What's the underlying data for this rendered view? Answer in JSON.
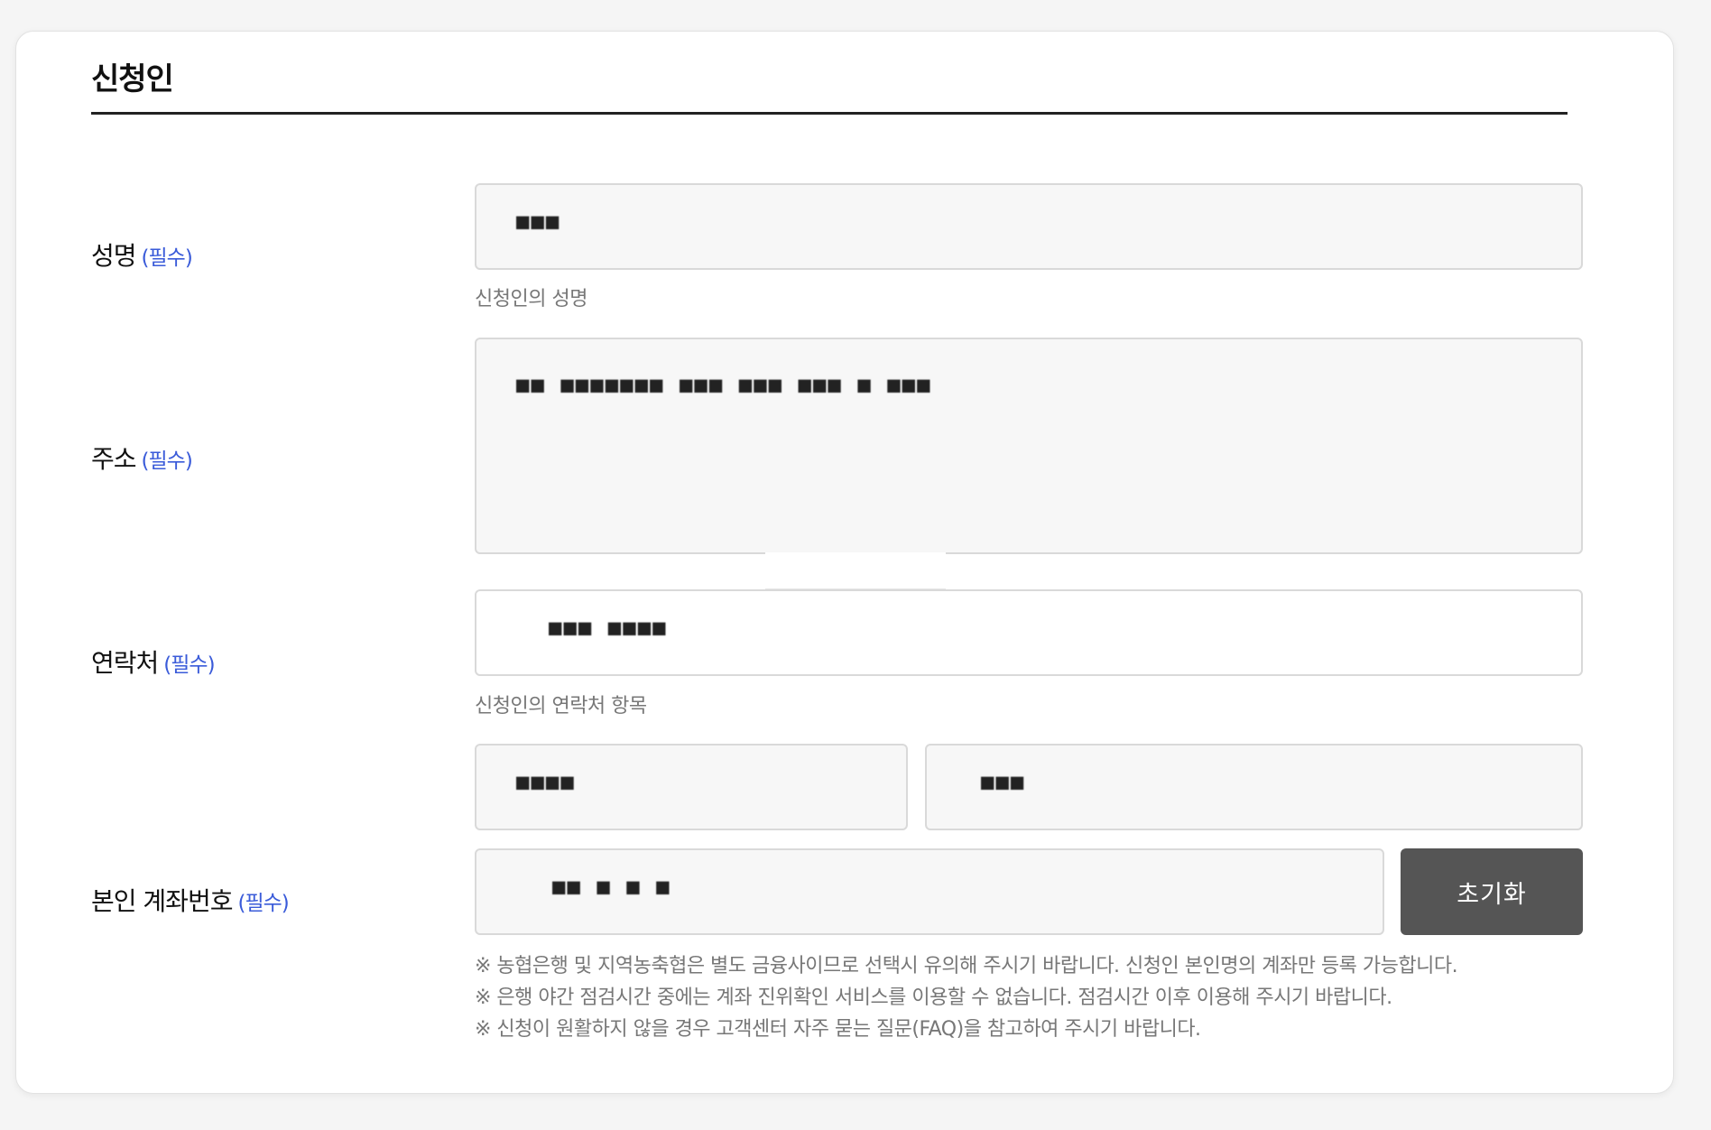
{
  "section": {
    "title": "신청인"
  },
  "required_tag": "(필수)",
  "name": {
    "label": "성명",
    "value": "■■■",
    "help": "신청인의 성명"
  },
  "address": {
    "label": "주소",
    "value": "■■ ■■■■■■■ ■■■ ■■■ ■■■ ■ ■■■"
  },
  "contact": {
    "label": "연락처",
    "value": "■■■ ■■■■",
    "help": "신청인의 연락처 항목"
  },
  "bank": {
    "label": "본인 계좌번호",
    "bank_value": "■■■■",
    "holder_value": "■■■",
    "account_value": "■■ ■ ■ ■",
    "reset_label": "초기화",
    "notes": [
      "※ 농협은행 및 지역농축협은 별도 금융사이므로 선택시 유의해 주시기 바랍니다. 신청인 본인명의 계좌만 등록 가능합니다.",
      "※ 은행 야간 점검시간 중에는 계좌 진위확인 서비스를 이용할 수 없습니다. 점검시간 이후 이용해 주시기 바랍니다.",
      "※ 신청이 원활하지 않을 경우 고객센터 자주 묻는 질문(FAQ)을 참고하여 주시기 바랍니다."
    ]
  }
}
